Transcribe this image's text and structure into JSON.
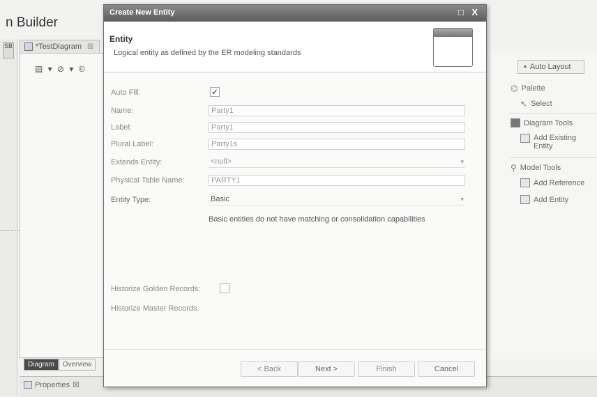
{
  "app": {
    "title": "n Builder"
  },
  "left_strip": {
    "mini_text": "SB"
  },
  "editor": {
    "tab_label": "*TestDiagram",
    "tab_close": "☒",
    "toolbar_glyphs": "▤ ▾ ⊘ ▾ ©"
  },
  "bottom_tabs": {
    "diagram": "Diagram",
    "overview": "Overview"
  },
  "properties": {
    "tab_label": "Properties",
    "tab_close": "☒"
  },
  "palette": {
    "auto_layout": "Auto Layout",
    "palette_label": "Palette",
    "select_label": "Select",
    "diagram_tools": "Diagram Tools",
    "add_existing_entity_line1": "Add Existing",
    "add_existing_entity_line2": "Entity",
    "model_tools": "Model Tools",
    "add_reference": "Add Reference",
    "add_entity": "Add Entity"
  },
  "dialog": {
    "title": "Create New Entity",
    "controls": "□ X",
    "header_title": "Entity",
    "header_description": "Logical entity as defined by the ER modeling standards",
    "fields": {
      "auto_fill": {
        "label": "Auto Fill:",
        "checked": true,
        "mark": "✓"
      },
      "name": {
        "label": "Name:",
        "value": "Party1"
      },
      "label": {
        "label": "Label:",
        "value": "Party1"
      },
      "plural_label": {
        "label": "Plural Label:",
        "value": "Party1s"
      },
      "extends_entity": {
        "label": "Extends Entity:",
        "value": "<null>"
      },
      "physical_table_name": {
        "label": "Physical Table Name:",
        "value": "PARTY1"
      },
      "entity_type": {
        "label": "Entity Type:",
        "value": "Basic",
        "description": "Basic entities do not have matching or consolidation capabilities"
      },
      "historize_golden": {
        "label": "Historize Golden Records:",
        "checked": false
      },
      "historize_master": {
        "label": "Historize Master Records:"
      }
    },
    "buttons": {
      "back": "< Back",
      "next": "Next >",
      "finish": "Finish",
      "cancel": "Cancel"
    }
  },
  "colors": {
    "titlebar": "#5b5b5b",
    "dialog_bg": "#fafaf9",
    "page_bg": "#f2f2f0"
  }
}
